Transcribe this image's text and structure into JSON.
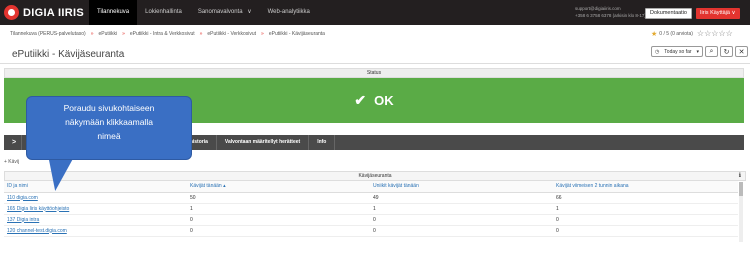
{
  "header": {
    "logo_text": "DIGIA IIRIS",
    "nav": [
      "Tilannekuva",
      "Lokienhallinta",
      "Sanomavalvonta",
      "Web-analytiikka"
    ],
    "nav_dropdown_mark": "∨",
    "support_lines": [
      "support@digiaiiris.com",
      "+358 6 3758 6378 (arkisin klo 8-17)"
    ],
    "doc_button": "Dokumentaatio",
    "user_button": "Iiris Käyttäjä ∨"
  },
  "breadcrumbs": [
    "Tilannekuva (PERUS-palvelutaso)",
    "ePutiikki",
    "ePutiikki - Intra & Verkkosivut",
    "ePutiikki - Verkkosivut",
    "ePutiikki - Kävijäseuranta"
  ],
  "rating": {
    "text": "0 / 5 (0 arviota)",
    "stars": "☆☆☆☆☆"
  },
  "page_title": "ePutiikki - Kävijäseuranta",
  "toolbar": {
    "range_label": "Today so far",
    "range_caret": "▾",
    "zoom_icon": "⌕",
    "refresh_icon": "↻",
    "close_icon": "✕"
  },
  "status": {
    "label": "Status",
    "value": "OK",
    "check": "✔"
  },
  "tabs": {
    "arrow": ">",
    "items": [
      "uotohistoria",
      "Valvontaan määritellyt herätteet",
      "Info"
    ]
  },
  "subhead": "+ Kävij",
  "table": {
    "title": "Kävijäseuranta",
    "info_icon": "ℹ",
    "columns": [
      "ID ja nimi",
      "Kävijät tänään ▴",
      "Uniikit kävijät tänään",
      "Kävijät viimeisen 2 tunnin aikana"
    ],
    "rows": [
      [
        "110 digia.com",
        "50",
        "49",
        "66"
      ],
      [
        "165 Digia Iiris käyttöohjeisto",
        "1",
        "1",
        "1"
      ],
      [
        "137 Digia intra",
        "0",
        "0",
        "0"
      ],
      [
        "120 channel-test.digia.com",
        "0",
        "0",
        "0"
      ]
    ]
  },
  "callout": {
    "lines": [
      "Poraudu sivukohtaiseen",
      "näkymään klikkaamalla",
      "nimeä"
    ]
  },
  "colors": {
    "ok_green": "#5aab46",
    "brand_red": "#e3342f",
    "callout_blue": "#3a6fc4"
  }
}
